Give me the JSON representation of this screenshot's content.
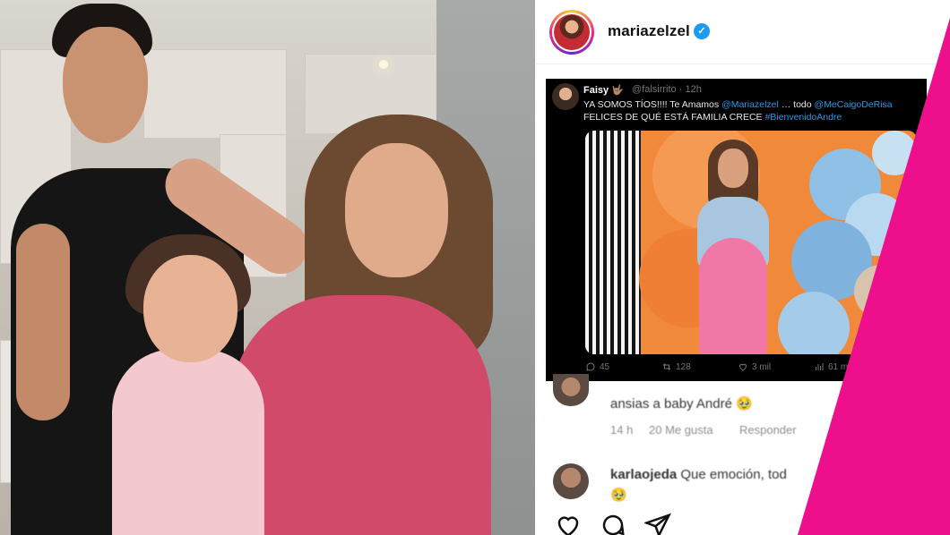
{
  "post": {
    "username": "mariazelzel",
    "verified_icon": "verified-badge-icon",
    "accent_color": "#ee0f8c"
  },
  "tweet": {
    "name": "Faisy",
    "emoji": "🤟🏽",
    "handle": "@falsirrito",
    "time": "· 12h",
    "text_line1_a": "YA SOMOS TÍOS!!!! Te Amamos ",
    "mention1": "@Mariazelzel",
    "text_line1_b": " … todo ",
    "mention2": "@MeCaigoDeRisa",
    "text_line2": "FELICES DE QUÉ ESTÁ FAMILIA CRECE ",
    "hashtag": "#BienvenidoAndre",
    "replies": "45",
    "retweets": "128",
    "likes": "3 mil",
    "views": "61 mil"
  },
  "comments": [
    {
      "text": "ansias a baby André 🥹",
      "time": "14 h",
      "likes": "20 Me gusta",
      "reply": "Responder"
    },
    {
      "user": "karlaojeda",
      "text": "Que emoción, tod",
      "text2": "🥹"
    }
  ],
  "actions": [
    "heart-icon",
    "comment-icon",
    "share-icon"
  ]
}
